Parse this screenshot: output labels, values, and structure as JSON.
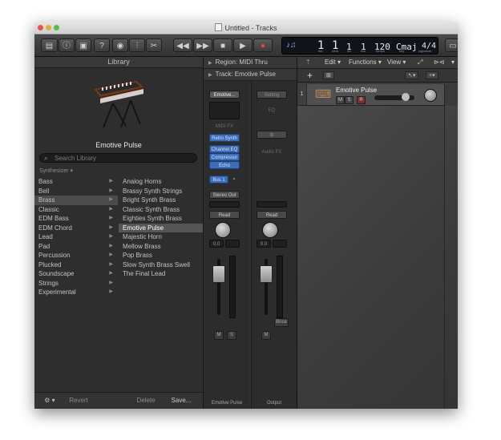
{
  "window": {
    "title": "Untitled - Tracks"
  },
  "lcd": {
    "bar": "1",
    "beat": "1",
    "div": "1",
    "tick": "1",
    "tempo": "120",
    "key": "Cmaj",
    "signature": "4/4",
    "labels": {
      "bar": "bar",
      "beat": "beat",
      "div": "div",
      "tick": "tick",
      "tempo": "tempo",
      "key": "key",
      "signature": "signature"
    }
  },
  "library": {
    "header": "Library",
    "patch_name": "Emotive Pulse",
    "search_placeholder": "Search Library",
    "crumb": "Synthesizer",
    "categories": [
      "Bass",
      "Bell",
      "Brass",
      "Classic",
      "EDM Bass",
      "EDM Chord",
      "Lead",
      "Pad",
      "Percussion",
      "Plucked",
      "Soundscape",
      "Strings",
      "Experimental"
    ],
    "patches": [
      "Analog Horns",
      "Brassy Synth Strings",
      "Bright Synth Brass",
      "Classic Synth Brass",
      "Eighties Synth Brass",
      "Emotive Pulse",
      "Majestic Horn",
      "Mellow Brass",
      "Pop Brass",
      "Slow Synth Brass Swell",
      "The Final Lead"
    ],
    "footer": {
      "revert": "Revert",
      "delete": "Delete",
      "save": "Save..."
    }
  },
  "inspector": {
    "region": "Region: MIDI Thru",
    "track": "Track:  Emotive Pulse",
    "strip1": {
      "setting": "Emotive...",
      "midi_fx": "MIDI FX",
      "instrument": "Retro Synth",
      "fx": [
        "Channel EQ",
        "Compressor",
        "Echo"
      ],
      "send": "Bus 1",
      "output": "Stereo Out",
      "automation": "Read",
      "volume": "0.0",
      "mute": "M",
      "solo": "S",
      "name": "Emotive Pulse"
    },
    "strip2": {
      "setting": "Setting",
      "eq": "EQ",
      "audio_fx": "Audio FX",
      "automation": "Read",
      "volume": "0.0",
      "mute": "M",
      "bounce": "Bnce",
      "name": "Output"
    }
  },
  "tracks": {
    "menus": [
      "Edit",
      "Functions",
      "View"
    ],
    "track1": {
      "number": "1",
      "name": "Emotive Pulse",
      "mute": "M",
      "solo": "S",
      "record": "R"
    }
  }
}
